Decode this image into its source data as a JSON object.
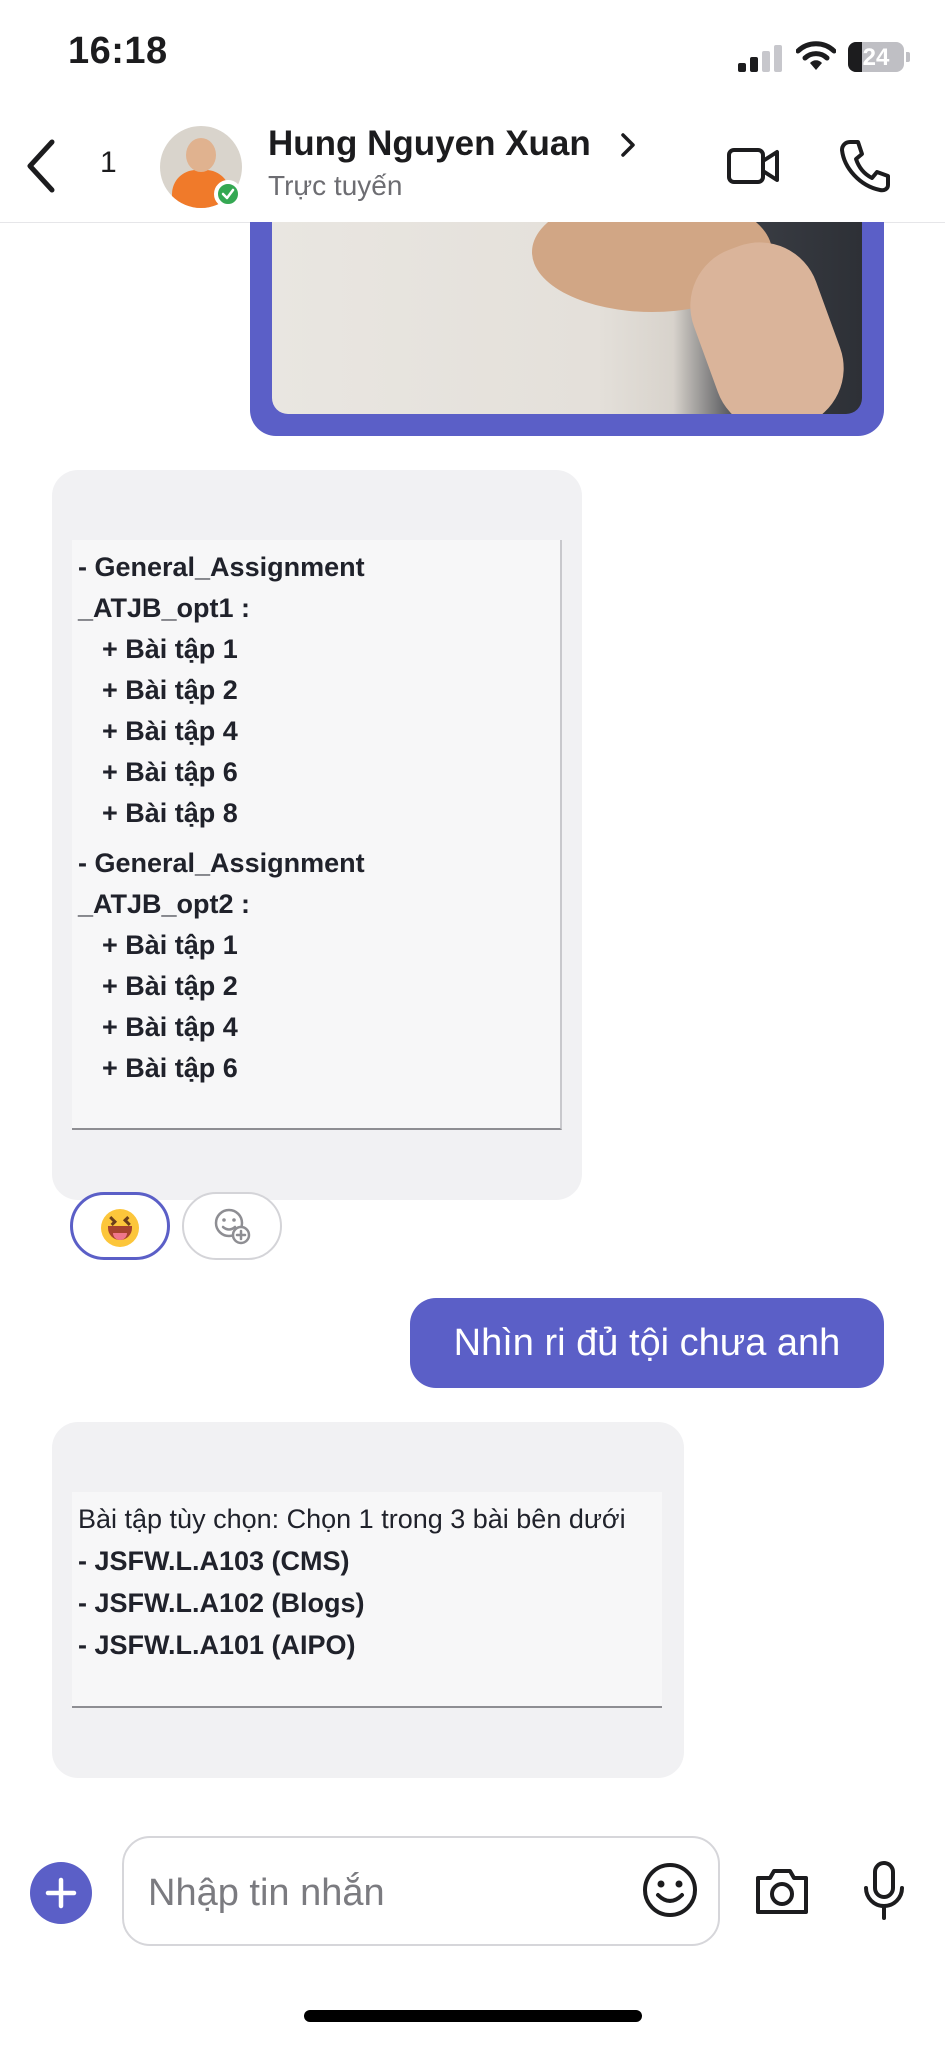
{
  "status_bar": {
    "time": "16:18",
    "battery_level": "24",
    "icons": [
      "signal-icon",
      "wifi-icon",
      "battery-icon"
    ]
  },
  "header": {
    "back_icon": "chevron-left-icon",
    "unread_count": "1",
    "contact_name": "Hung Nguyen Xuan",
    "contact_status": "Trực tuyến",
    "presence_color": "#35a853",
    "actions": [
      "video-call-icon",
      "phone-call-icon"
    ]
  },
  "messages": {
    "card1": {
      "lines": [
        "- General_Assignment",
        "_ATJB_opt1 :",
        "+ Bài tập 1",
        "+ Bài tập 2",
        "+ Bài tập 4",
        "+ Bài tập 6",
        "+ Bài tập 8",
        "- General_Assignment",
        "_ATJB_opt2 :",
        "+ Bài tập 1",
        "+ Bài tập 2",
        "+ Bài tập 4",
        "+ Bài tập 6"
      ],
      "reactions": [
        "laughing-emoji-icon",
        "add-reaction-icon"
      ]
    },
    "outgoing_text": "Nhìn ri đủ tội chưa anh",
    "card2": {
      "lines": [
        "Bài tập tùy chọn: Chọn 1 trong 3 bài bên dưới",
        "- JSFW.L.A103 (CMS)",
        "- JSFW.L.A102 (Blogs)",
        "- JSFW.L.A101 (AIPO)"
      ]
    }
  },
  "composer": {
    "placeholder": "Nhập tin nhắn",
    "value": "",
    "icons": [
      "plus-icon",
      "emoji-icon",
      "camera-icon",
      "microphone-icon"
    ]
  },
  "theme": {
    "accent": "#5b5fc7",
    "bubble_gray": "#f1f1f3"
  }
}
